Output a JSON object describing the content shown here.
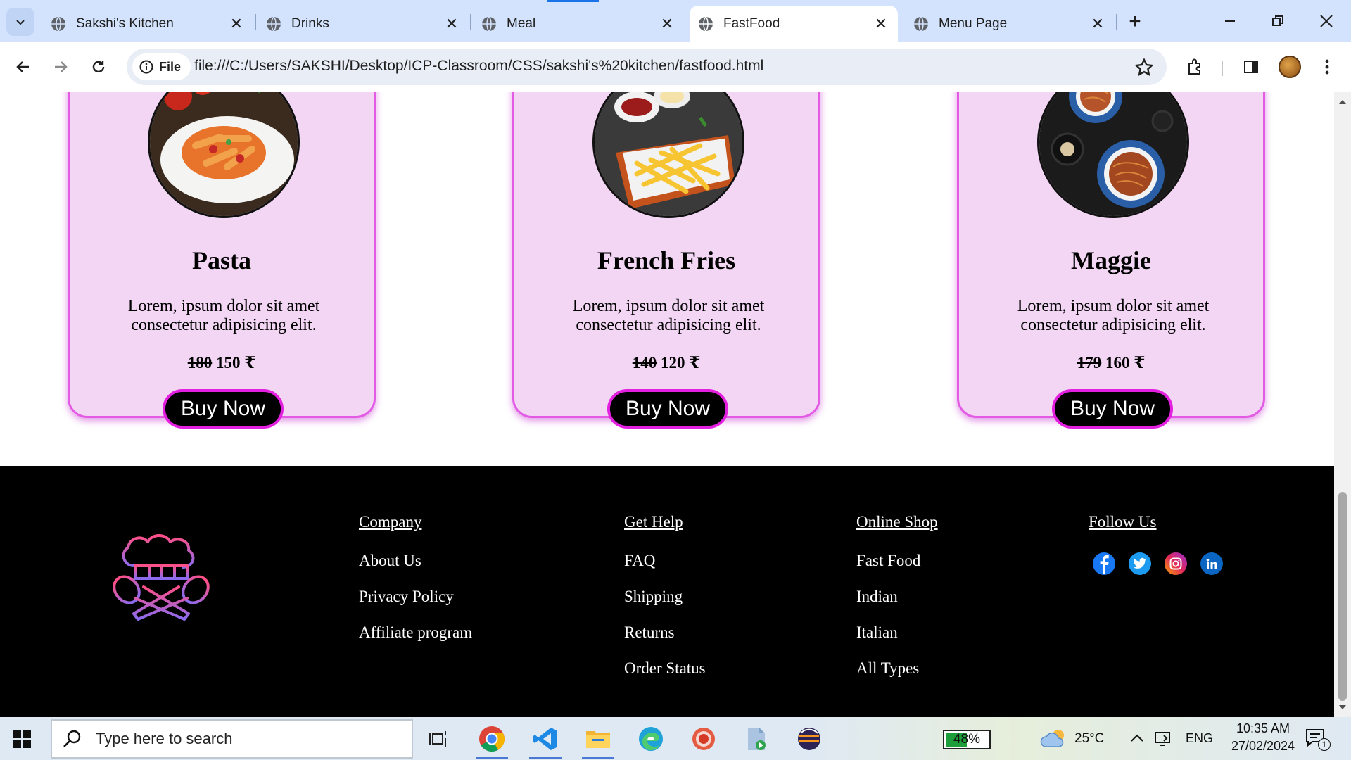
{
  "browser": {
    "tabs": [
      {
        "title": "Sakshi's Kitchen",
        "active": false
      },
      {
        "title": "Drinks",
        "active": false
      },
      {
        "title": "Meal",
        "active": false
      },
      {
        "title": "FastFood",
        "active": true
      },
      {
        "title": "Menu Page",
        "active": false
      }
    ],
    "site_chip": "File",
    "url": "file:///C:/Users/SAKSHI/Desktop/ICP-Classroom/CSS/sakshi's%20kitchen/fastfood.html"
  },
  "cards": [
    {
      "title": "Pasta",
      "desc_line1": "Lorem, ipsum dolor sit amet",
      "desc_line2": "consectetur adipisicing elit.",
      "old_price": "180",
      "new_price": "150 ₹",
      "button": "Buy Now"
    },
    {
      "title": "French Fries",
      "desc_line1": "Lorem, ipsum dolor sit amet",
      "desc_line2": "consectetur adipisicing elit.",
      "old_price": "140",
      "new_price": "120 ₹",
      "button": "Buy Now"
    },
    {
      "title": "Maggie",
      "desc_line1": "Lorem, ipsum dolor sit amet",
      "desc_line2": "consectetur adipisicing elit.",
      "old_price": "179",
      "new_price": "160 ₹",
      "button": "Buy Now"
    }
  ],
  "footer": {
    "company": {
      "heading": "Company",
      "links": [
        "About Us",
        "Privacy Policy",
        "Affiliate program"
      ]
    },
    "help": {
      "heading": "Get Help",
      "links": [
        "FAQ",
        "Shipping",
        "Returns",
        "Order Status"
      ]
    },
    "shop": {
      "heading": "Online Shop",
      "links": [
        "Fast Food",
        "Indian",
        "Italian",
        "All Types"
      ]
    },
    "follow": {
      "heading": "Follow Us",
      "icons": [
        "facebook-icon",
        "twitter-icon",
        "instagram-icon",
        "linkedin-icon"
      ]
    }
  },
  "taskbar": {
    "search_placeholder": "Type here to search",
    "battery": "48%",
    "temperature": "25°C",
    "language": "ENG",
    "time": "10:35 AM",
    "date": "27/02/2024",
    "notification_count": "1"
  },
  "colors": {
    "card_bg": "#f2d6f4",
    "card_border": "#e35be5",
    "button_border": "#e31fe0",
    "footer_bg": "#000000"
  }
}
